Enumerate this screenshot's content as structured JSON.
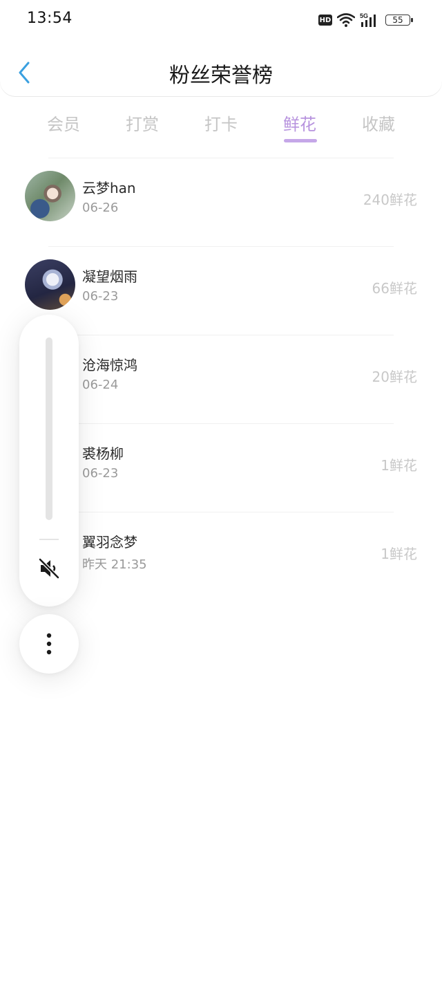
{
  "status_bar": {
    "time": "13:54",
    "hd_label": "HD",
    "network_label": "5G",
    "battery": "55"
  },
  "header": {
    "title": "粉丝荣誉榜",
    "back_icon": "chevron-left-icon"
  },
  "tabs": [
    {
      "label": "会员",
      "active": false
    },
    {
      "label": "打赏",
      "active": false
    },
    {
      "label": "打卡",
      "active": false
    },
    {
      "label": "鲜花",
      "active": true
    },
    {
      "label": "收藏",
      "active": false
    }
  ],
  "list": [
    {
      "name": "云梦han",
      "date": "06-26",
      "amount": "240鲜花"
    },
    {
      "name": "凝望烟雨",
      "date": "06-23",
      "amount": "66鲜花"
    },
    {
      "name": "沧海惊鸿",
      "date": "06-24",
      "amount": "20鲜花"
    },
    {
      "name": "裘杨柳",
      "date": "06-23",
      "amount": "1鲜花"
    },
    {
      "name": "翼羽念梦",
      "date": "昨天 21:35",
      "amount": "1鲜花"
    }
  ],
  "volume_panel": {
    "mute_icon": "speaker-mute-icon",
    "more_icon": "more-vertical-icon"
  },
  "colors": {
    "accent": "#b793de",
    "back_arrow": "#3aa0e0",
    "inactive_tab": "#c5c5c5"
  }
}
